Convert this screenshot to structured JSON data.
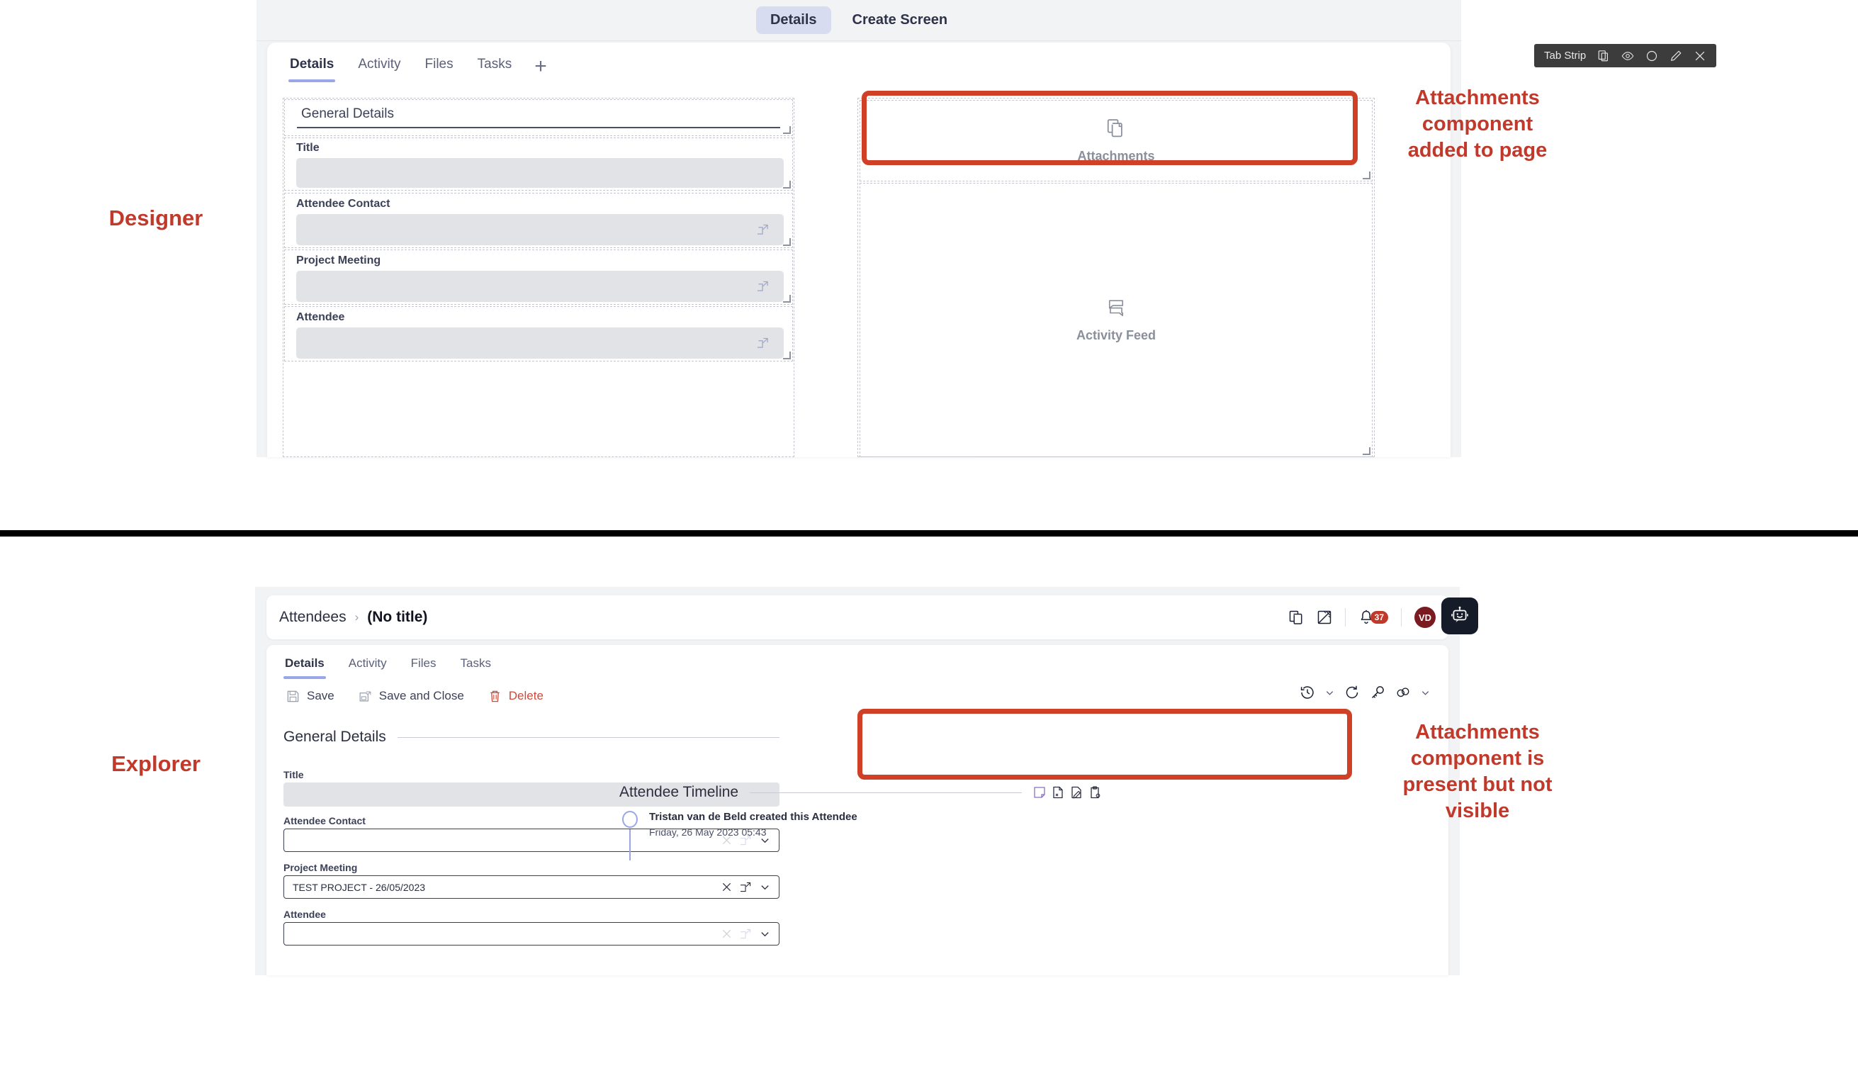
{
  "designer": {
    "label": "Designer",
    "topbar": {
      "tabs": [
        "Details",
        "Create Screen"
      ],
      "active": "Details"
    },
    "form_tabs": [
      "Details",
      "Activity",
      "Files",
      "Tasks"
    ],
    "form_tabs_active": "Details",
    "add_tab_glyph": "+",
    "section_title": "General Details",
    "fields": [
      {
        "label": "Title",
        "lookup": false
      },
      {
        "label": "Attendee Contact",
        "lookup": true
      },
      {
        "label": "Project Meeting",
        "lookup": true
      },
      {
        "label": "Attendee",
        "lookup": true
      }
    ],
    "components": [
      {
        "name": "Attachments",
        "icon": "copy-documents-icon"
      },
      {
        "name": "Activity Feed",
        "icon": "chat-bubbles-icon"
      }
    ],
    "tab_strip_toolbar": {
      "label": "Tab Strip",
      "icons": [
        "duplicate-icon",
        "eye-icon",
        "circle-icon",
        "pencil-icon",
        "close-icon"
      ]
    },
    "annotation": "Attachments\ncomponent\nadded to page"
  },
  "explorer": {
    "label": "Explorer",
    "breadcrumb": {
      "root": "Attendees",
      "separator": "›",
      "current": "(No title)"
    },
    "header_icons": [
      "copy-icon",
      "ruler-pencil-icon",
      "bell-icon",
      "avatar",
      "bot-icon"
    ],
    "notification_count": "37",
    "avatar_initials": "VD",
    "tabs": [
      "Details",
      "Activity",
      "Files",
      "Tasks"
    ],
    "tabs_active": "Details",
    "actions": [
      {
        "label": "Save",
        "icon": "save-icon"
      },
      {
        "label": "Save and Close",
        "icon": "save-and-close-icon"
      },
      {
        "label": "Delete",
        "icon": "trash-icon"
      }
    ],
    "right_tools": [
      "history-icon",
      "refresh-icon",
      "key-icon",
      "links-icon"
    ],
    "section_title": "General Details",
    "fields": [
      {
        "label": "Title",
        "value": "",
        "type": "readonly"
      },
      {
        "label": "Attendee Contact",
        "value": "",
        "type": "lookup"
      },
      {
        "label": "Project Meeting",
        "value": "TEST PROJECT - 26/05/2023",
        "type": "lookup"
      },
      {
        "label": "Attendee",
        "value": "",
        "type": "lookup"
      }
    ],
    "timeline": {
      "title": "Attendee Timeline",
      "toolbar_icons": [
        "note-icon",
        "new-doc-icon",
        "edit-doc-icon",
        "clipboard-icon"
      ],
      "entries": [
        {
          "title": "Tristan van de Beld created this Attendee",
          "timestamp": "Friday, 26 May 2023 05:43"
        }
      ]
    },
    "annotation": "Attachments\ncomponent is\npresent but not\nvisible"
  },
  "colors": {
    "accent_red": "#c0392b",
    "callout_red": "#cf4026",
    "tab_underline": "#9aa6e8",
    "badge_red": "#c0392b",
    "avatar_bg": "#7a1a21"
  }
}
